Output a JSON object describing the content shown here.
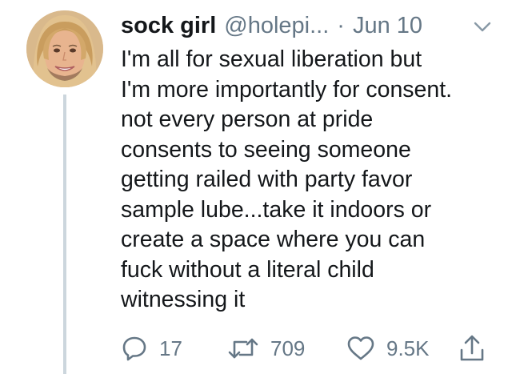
{
  "tweet": {
    "author": {
      "display_name": "sock girl",
      "handle": "@holepi...",
      "avatar_icon": "profile-photo"
    },
    "separator": "·",
    "date": "Jun 10",
    "text_lines": [
      "I'm all for sexual liberation but",
      "I'm more importantly for consent.",
      "not every person at pride",
      "consents to seeing someone",
      "getting railed with party favor",
      "sample lube...take it indoors or",
      "create a space where you can",
      "fuck without a literal child",
      "witnessing it"
    ],
    "actions": {
      "reply_count": "17",
      "retweet_count": "709",
      "like_count": "9.5K",
      "icons": [
        "reply-icon",
        "retweet-icon",
        "heart-icon",
        "share-icon"
      ]
    },
    "colors": {
      "text": "#14171a",
      "secondary": "#657786",
      "thread_line": "#ccd6dd"
    }
  }
}
